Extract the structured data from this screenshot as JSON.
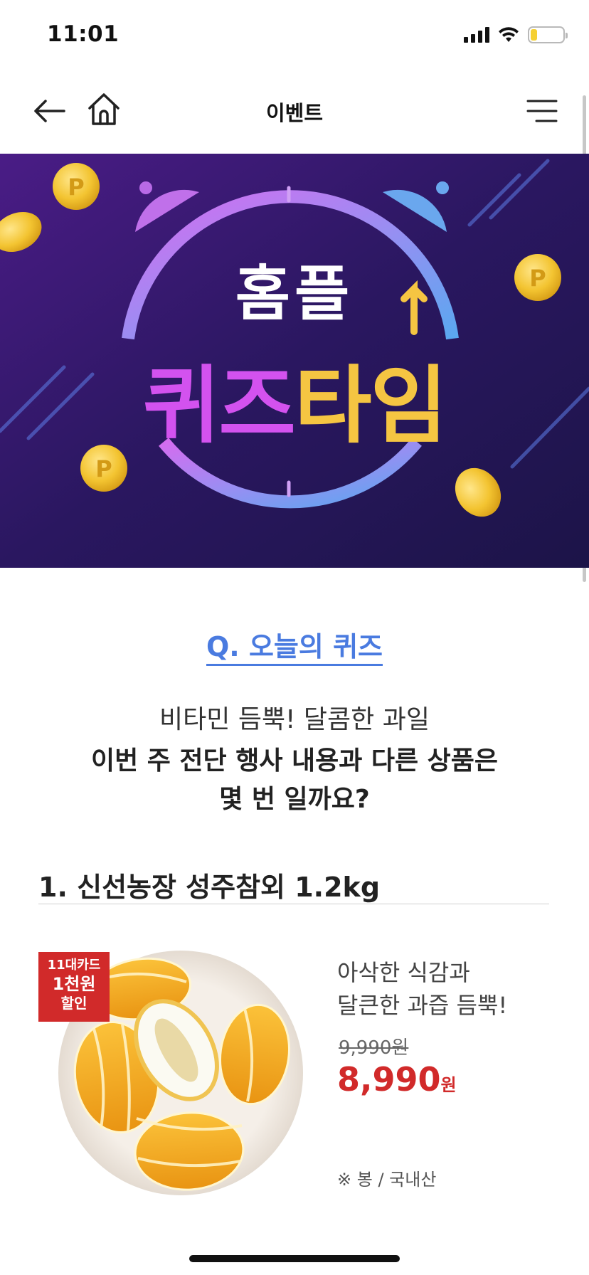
{
  "status_bar": {
    "time": "11:01",
    "signal_icon": "cellular-signal-icon",
    "wifi_icon": "wifi-icon",
    "battery_icon": "battery-icon",
    "battery_level": 0.2
  },
  "nav": {
    "back_icon": "arrow-left-icon",
    "home_icon": "home-icon",
    "title": "이벤트",
    "menu_icon": "hamburger-menu-icon"
  },
  "banner": {
    "top_text": "홈플",
    "main_text_pink": "퀴즈",
    "main_text_yellow": "타임",
    "coin_letter": "P",
    "colors": {
      "background": "#2a1760",
      "pink": "#d352ef",
      "yellow": "#f5c542",
      "coin": "#f3c431"
    }
  },
  "quiz": {
    "heading": "Q. 오늘의 퀴즈",
    "line1": "비타민 듬뿍! 달콤한 과일",
    "line2": "이번 주 전단 행사 내용과 다른 상품은",
    "line3": "몇 번 일까요?"
  },
  "product": {
    "title": "1. 신선농장 성주참외 1.2kg",
    "badge": {
      "line1": "11대카드",
      "line2": "1천원",
      "line3": "할인"
    },
    "desc1": "아삭한 식감과",
    "desc2": "달큰한 과즙 듬뿍!",
    "original_price": "9,990원",
    "sale_price": "8,990",
    "sale_unit": "원",
    "origin": "※ 봉 / 국내산",
    "colors": {
      "price": "#d12a2a",
      "badge": "#d12a2a"
    }
  },
  "colors": {
    "accent_blue": "#4a7be0"
  }
}
